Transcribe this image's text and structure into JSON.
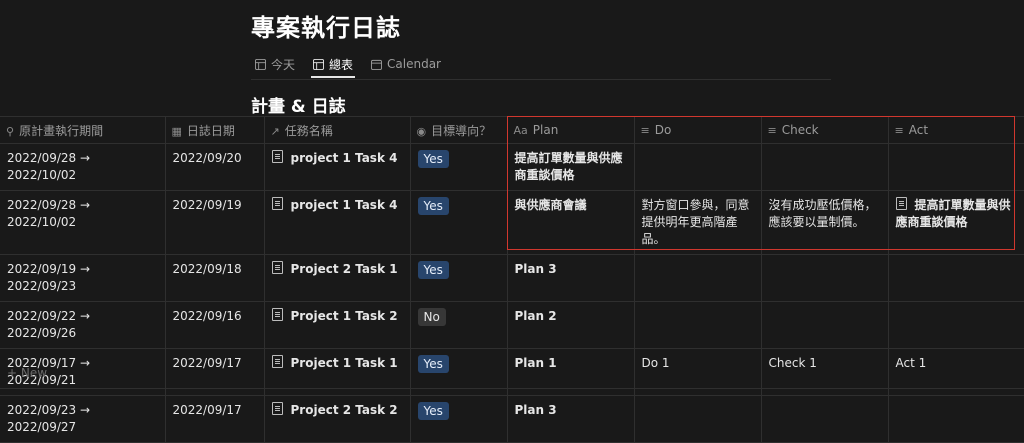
{
  "page": {
    "title": "專案執行日誌",
    "section_title": "計畫 & 日誌"
  },
  "views": [
    {
      "label": "今天",
      "icon": "table-icon"
    },
    {
      "label": "總表",
      "icon": "table-icon"
    },
    {
      "label": "Calendar",
      "icon": "calendar-icon"
    }
  ],
  "columns": [
    {
      "label": "原計畫執行期間",
      "icon": "search-icon"
    },
    {
      "label": "日誌日期",
      "icon": "calendar-icon"
    },
    {
      "label": "任務名稱",
      "icon": "arrow-up-right-icon"
    },
    {
      "label": "目標導向？",
      "icon": "select-icon"
    },
    {
      "label": "Plan",
      "icon": "title-icon"
    },
    {
      "label": "Do",
      "icon": "text-icon"
    },
    {
      "label": "Check",
      "icon": "text-icon"
    },
    {
      "label": "Act",
      "icon": "text-icon"
    }
  ],
  "rows": [
    {
      "period": "2022/09/28 → 2022/10/02",
      "date": "2022/09/20",
      "task": "project 1 Task 4",
      "goal": "Yes",
      "plan": "提高訂單數量與供應商重談價格",
      "do": "",
      "check": "",
      "act": ""
    },
    {
      "period": "2022/09/28 → 2022/10/02",
      "date": "2022/09/19",
      "task": "project 1 Task 4",
      "goal": "Yes",
      "plan": "與供應商會議",
      "do": "對方窗口參與，同意提供明年更高階產品。",
      "check": "沒有成功壓低價格，應該要以量制價。",
      "act": "提高訂單數量與供應商重談價格"
    },
    {
      "period": "2022/09/19 → 2022/09/23",
      "date": "2022/09/18",
      "task": "Project 2 Task 1",
      "goal": "Yes",
      "plan": "Plan 3",
      "do": "",
      "check": "",
      "act": ""
    },
    {
      "period": "2022/09/22 → 2022/09/26",
      "date": "2022/09/16",
      "task": "Project 1 Task 2",
      "goal": "No",
      "plan": "Plan 2",
      "do": "",
      "check": "",
      "act": ""
    },
    {
      "period": "2022/09/17 → 2022/09/21",
      "date": "2022/09/17",
      "task": "Project 1 Task 1",
      "goal": "Yes",
      "plan": "Plan 1",
      "do": "Do 1",
      "check": "Check 1",
      "act": "Act 1"
    },
    {
      "period": "2022/09/23 → 2022/09/27",
      "date": "2022/09/17",
      "task": "Project 2 Task 2",
      "goal": "Yes",
      "plan": "Plan 3",
      "do": "",
      "check": "",
      "act": ""
    }
  ],
  "new_row_label": "+ New",
  "colors": {
    "background": "#191919",
    "tag_yes": "#28456c",
    "tag_no": "#373737",
    "highlight_box": "#d1372e"
  }
}
